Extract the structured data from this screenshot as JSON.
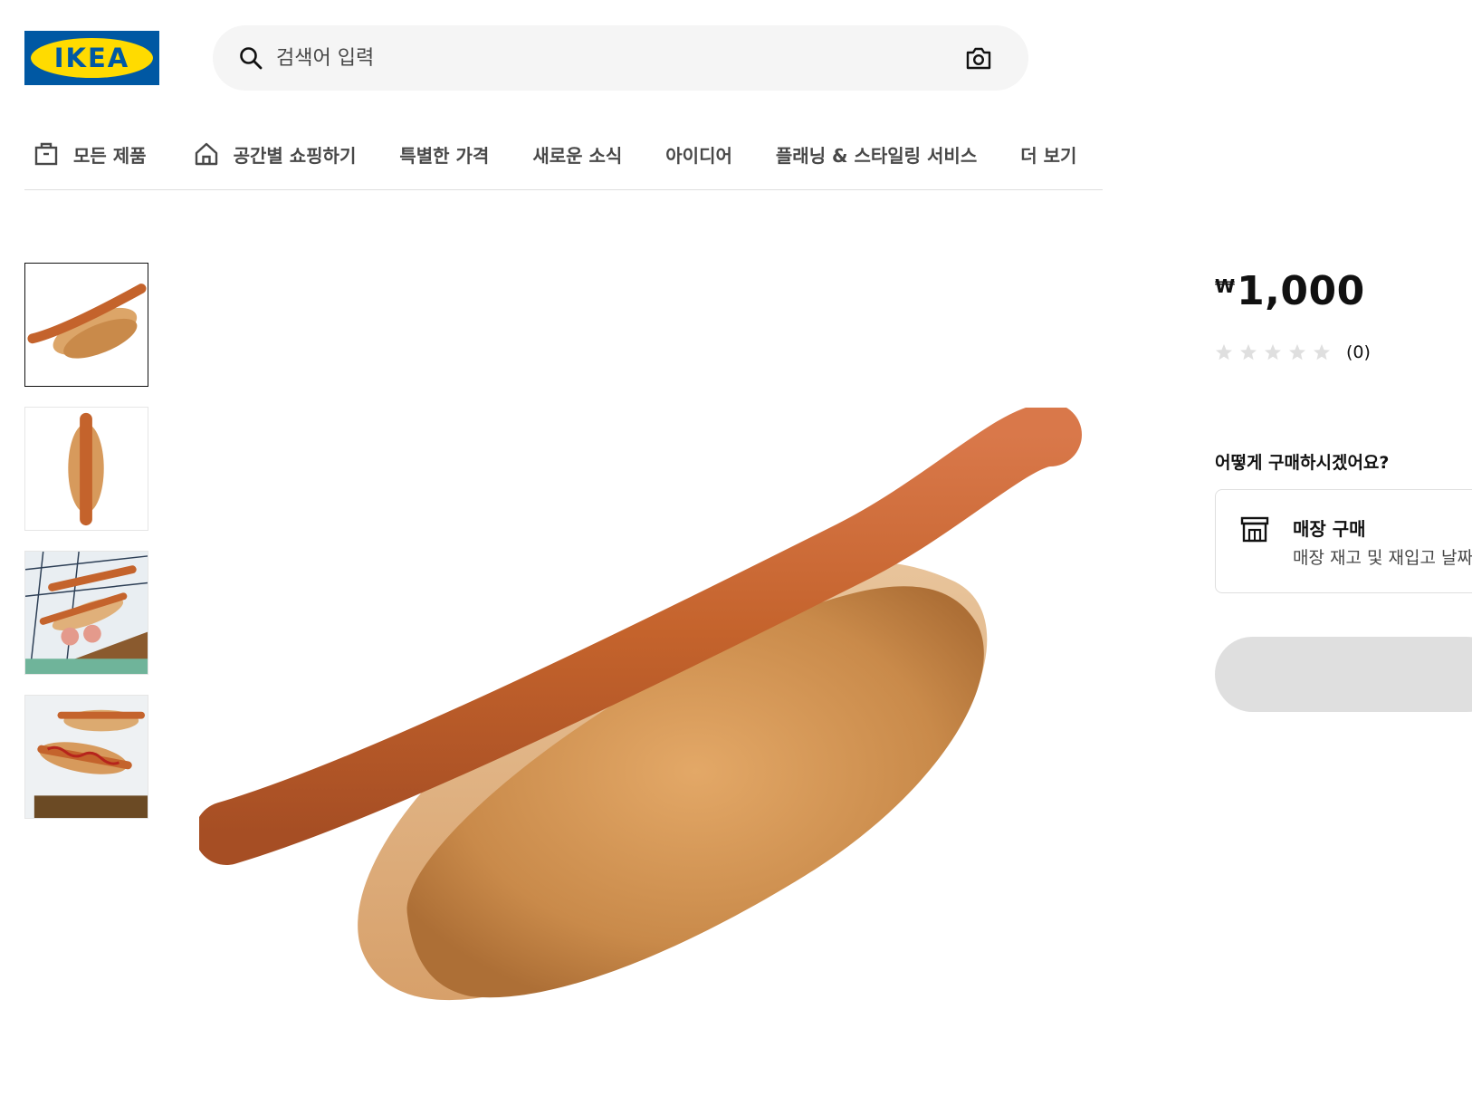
{
  "header": {
    "logo_text": "IKEA",
    "search": {
      "placeholder": "검색어 입력",
      "search_icon": "search-icon",
      "camera_icon": "camera-icon"
    }
  },
  "nav": {
    "items": [
      {
        "label": "모든 제품",
        "icon": "storage-box-icon"
      },
      {
        "label": "공간별 쇼핑하기",
        "icon": "home-icon"
      },
      {
        "label": "특별한 가격"
      },
      {
        "label": "새로운 소식"
      },
      {
        "label": "아이디어"
      },
      {
        "label": "플래닝 & 스타일링 서비스"
      },
      {
        "label": "더 보기"
      }
    ]
  },
  "gallery": {
    "thumbnails": [
      {
        "name": "hotdog-angled",
        "active": true
      },
      {
        "name": "hotdog-top-view",
        "active": false
      },
      {
        "name": "hotdogs-on-board",
        "active": false
      },
      {
        "name": "hotdogs-with-ketchup",
        "active": false
      }
    ]
  },
  "product": {
    "currency": "₩",
    "price": "1,000",
    "rating_stars": 0,
    "rating_max": 5,
    "rating_count": "(0)"
  },
  "purchase": {
    "heading": "어떻게 구매하시겠어요?",
    "store": {
      "title": "매장 구매",
      "subtitle": "매장 재고 및 재입고 날짜",
      "icon": "store-icon"
    }
  },
  "colors": {
    "ikea_blue": "#0058a3",
    "ikea_yellow": "#ffdb00",
    "disabled_button": "#dfdfdf"
  }
}
